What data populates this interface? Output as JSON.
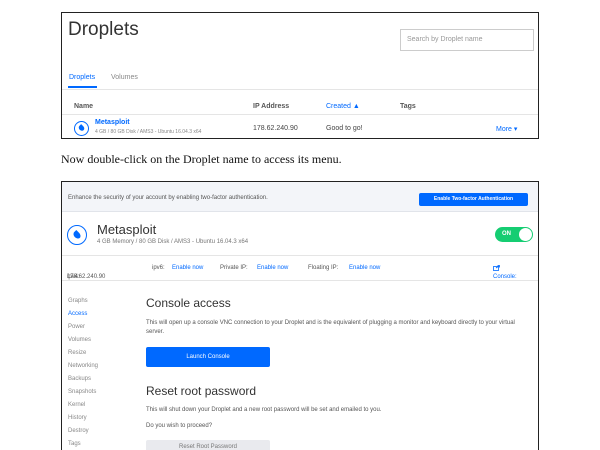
{
  "droplets_list": {
    "title": "Droplets",
    "search_placeholder": "Search by Droplet name",
    "tabs": [
      {
        "label": "Droplets",
        "active": true
      },
      {
        "label": "Volumes",
        "active": false
      }
    ],
    "columns": {
      "name": "Name",
      "ip": "IP Address",
      "created": "Created",
      "created_sort_icon": "▲",
      "tags": "Tags"
    },
    "rows": [
      {
        "name": "Metasploit",
        "meta": "4 GB / 80 GB Disk / AMS3 - Ubuntu 16.04.3 x64",
        "ip": "178.62.240.90",
        "created": "Good to go!",
        "more": "More ▾"
      }
    ]
  },
  "caption": "Now double-click on the Droplet name to access its menu.",
  "droplet_detail": {
    "banner_text": "Enhance the security of your account by enabling two-factor authentication.",
    "banner_button": "Enable Two-factor Authentication",
    "name": "Metasploit",
    "meta": "4 GB Memory / 80 GB Disk / AMS3 - Ubuntu 16.04.3 x64",
    "toggle_label": "ON",
    "network": {
      "ipv4_label": "ipv4:",
      "ipv4_value": "178.62.240.90",
      "ipv6_label": "ipv6:",
      "ipv6_link": "Enable now",
      "private_label": "Private IP:",
      "private_link": "Enable now",
      "floating_label": "Floating IP:",
      "floating_link": "Enable now",
      "console_link": "Console:"
    },
    "sidebar": [
      {
        "label": "Graphs",
        "active": false
      },
      {
        "label": "Access",
        "active": true
      },
      {
        "label": "Power",
        "active": false
      },
      {
        "label": "Volumes",
        "active": false
      },
      {
        "label": "Resize",
        "active": false
      },
      {
        "label": "Networking",
        "active": false
      },
      {
        "label": "Backups",
        "active": false
      },
      {
        "label": "Snapshots",
        "active": false
      },
      {
        "label": "Kernel",
        "active": false
      },
      {
        "label": "History",
        "active": false
      },
      {
        "label": "Destroy",
        "active": false
      },
      {
        "label": "Tags",
        "active": false
      }
    ],
    "console_section": {
      "heading": "Console access",
      "description": "This will open up a console VNC connection to your Droplet and is the equivalent of plugging a monitor and keyboard directly to your virtual server.",
      "button": "Launch Console"
    },
    "reset_section": {
      "heading": "Reset root password",
      "description": "This will shut down your Droplet and a new root password will be set and emailed to you.",
      "question": "Do you wish to proceed?",
      "button": "Reset Root Password"
    }
  },
  "colors": {
    "accent": "#0069ff",
    "toggle_on": "#15cd72"
  },
  "icons": {
    "droplet": "droplet-icon",
    "console": "external-window-icon",
    "chevron": "chevron-down-icon"
  }
}
